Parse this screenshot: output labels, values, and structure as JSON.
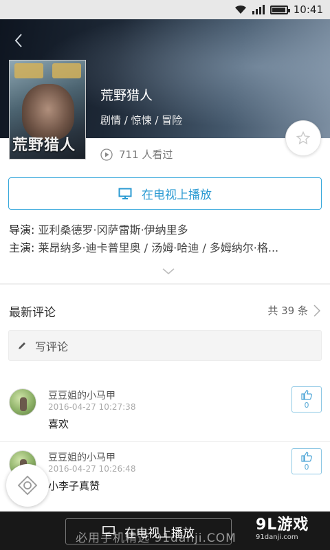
{
  "status_bar": {
    "time": "10:41"
  },
  "movie": {
    "title": "荒野猎人",
    "genres": "剧情 / 惊悚 / 冒险",
    "poster_title": "荒野猎人",
    "view_count": "711 人看过"
  },
  "actions": {
    "tv_play_label": "在电视上播放"
  },
  "credits": {
    "director_label": "导演:",
    "director": "亚利桑德罗·冈萨雷斯·伊纳里多",
    "cast_label": "主演:",
    "cast": "莱昂纳多·迪卡普里奥 / 汤姆·哈迪 / 多姆纳尔·格..."
  },
  "comments": {
    "header": "最新评论",
    "count": "共 39 条",
    "write_placeholder": "写评论",
    "items": [
      {
        "user": "豆豆姐的小马甲",
        "time": "2016-04-27 10:27:38",
        "text": "喜欢",
        "likes": "0"
      },
      {
        "user": "豆豆姐的小马甲",
        "time": "2016-04-27 10:26:48",
        "text": "小李子真赞",
        "likes": "0"
      }
    ]
  },
  "bottom": {
    "tv_play_label": "在电视上播放",
    "watermark": "必用手机精选  91danji.COM",
    "brand": "9L游戏",
    "brand_url": "91danji.com"
  },
  "colors": {
    "accent": "#2a9ad2",
    "bottom_bar": "#181818"
  },
  "icons": [
    "wifi-icon",
    "signal-icon",
    "battery-icon",
    "back-arrow-icon",
    "star-icon",
    "play-circle-icon",
    "tv-icon",
    "chevron-down-icon",
    "chevron-right-icon",
    "pencil-icon",
    "thumbs-up-icon",
    "remote-control-icon"
  ]
}
